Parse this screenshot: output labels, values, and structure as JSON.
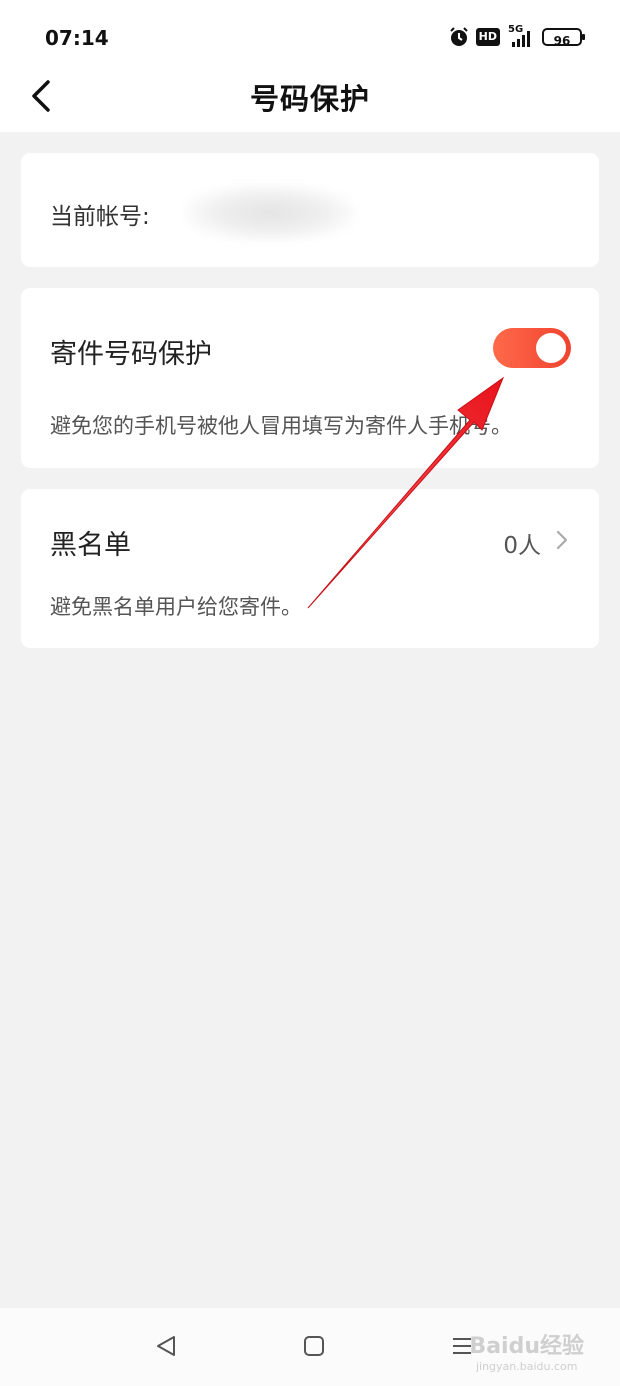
{
  "status_bar": {
    "time": "07:14",
    "icons": [
      "alarm-icon",
      "hd-icon",
      "5g-signal-icon",
      "battery-icon"
    ],
    "hd_label": "HD",
    "network_label": "5G",
    "battery_level": "96"
  },
  "header": {
    "back_icon": "back-chevron-icon",
    "title": "号码保护"
  },
  "account": {
    "label": "当前帐号:"
  },
  "sender_protection": {
    "title": "寄件号码保护",
    "enabled": true,
    "description": "避免您的手机号被他人冒用填写为寄件人手机号。",
    "toggle_color": "#f04a35"
  },
  "blacklist": {
    "title": "黑名单",
    "count": "0人",
    "description": "避免黑名单用户给您寄件。"
  },
  "annotation": {
    "arrow_color": "#e8121b"
  },
  "bottom_nav": {
    "icons": [
      "back-triangle-icon",
      "home-square-icon",
      "menu-lines-icon"
    ]
  },
  "watermark": {
    "main": "Baidu经验",
    "sub": "jingyan.baidu.com"
  }
}
